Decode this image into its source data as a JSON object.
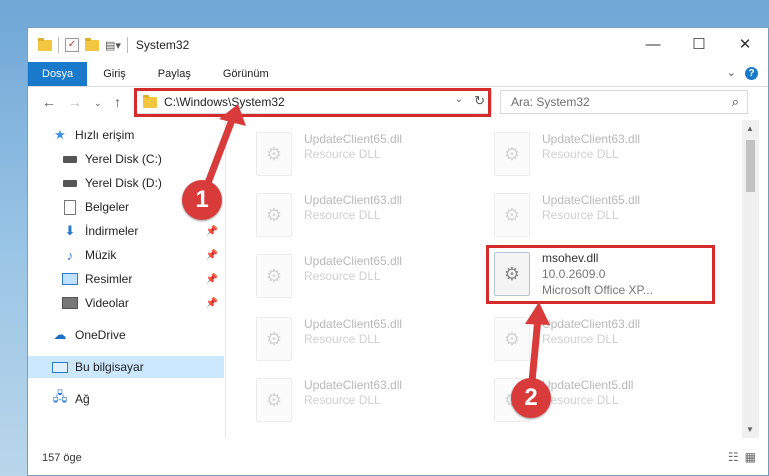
{
  "window": {
    "title": "System32"
  },
  "title_controls": {
    "minimize": "—",
    "maximize": "☐",
    "close": "✕"
  },
  "ribbon": {
    "tabs": [
      {
        "label": "Dosya"
      },
      {
        "label": "Giriş"
      },
      {
        "label": "Paylaş"
      },
      {
        "label": "Görünüm"
      }
    ],
    "help": "?"
  },
  "address": {
    "path": "C:\\Windows\\System32"
  },
  "search": {
    "placeholder": "Ara: System32"
  },
  "sidebar": {
    "items": [
      {
        "label": "Hızlı erişim",
        "icon": "star-icon"
      },
      {
        "label": "Yerel Disk (C:)",
        "icon": "drive-icon"
      },
      {
        "label": "Yerel Disk (D:)",
        "icon": "drive-icon"
      },
      {
        "label": "Belgeler",
        "icon": "document-icon"
      },
      {
        "label": "İndirmeler",
        "icon": "download-icon"
      },
      {
        "label": "Müzik",
        "icon": "music-icon"
      },
      {
        "label": "Resimler",
        "icon": "pictures-icon"
      },
      {
        "label": "Videolar",
        "icon": "video-icon"
      },
      {
        "label": "OneDrive",
        "icon": "cloud-icon"
      },
      {
        "label": "Bu bilgisayar",
        "icon": "computer-icon"
      },
      {
        "label": "Ağ",
        "icon": "network-icon"
      }
    ]
  },
  "files": [
    {
      "name": "UpdateClient65.dll",
      "sub": "Resource DLL"
    },
    {
      "name": "UpdateClient63.dll",
      "sub": "Resource DLL"
    },
    {
      "name": "UpdateClient63.dll",
      "sub": "Resource DLL"
    },
    {
      "name": "UpdateClient65.dll",
      "sub": "Resource DLL"
    },
    {
      "name": "UpdateClient65.dll",
      "sub": "Resource DLL"
    },
    {
      "name": "msohev.dll",
      "version": "10.0.2609.0",
      "sub": "Microsoft Office XP..."
    },
    {
      "name": "UpdateClient65.dll",
      "sub": "Resource DLL"
    },
    {
      "name": "UpdateClient63.dll",
      "sub": "Resource DLL"
    },
    {
      "name": "UpdateClient63.dll",
      "sub": "Resource DLL"
    },
    {
      "name": "UpdateClient5.dll",
      "sub": "Resource DLL"
    }
  ],
  "status": {
    "count": "157 öge"
  },
  "annotations": {
    "step1": "1",
    "step2": "2",
    "accent": "#d62b2b"
  }
}
